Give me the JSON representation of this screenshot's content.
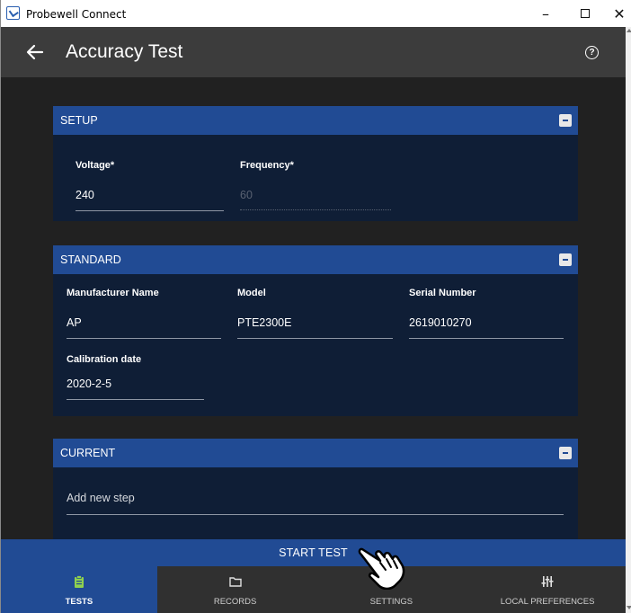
{
  "window": {
    "title": "Probewell Connect",
    "min": "–",
    "close": "✕"
  },
  "header": {
    "title": "Accuracy Test"
  },
  "setup": {
    "title": "SETUP",
    "voltage": {
      "label": "Voltage*",
      "value": "240"
    },
    "frequency": {
      "label": "Frequency*",
      "value": "60"
    }
  },
  "standard": {
    "title": "STANDARD",
    "manufacturer": {
      "label": "Manufacturer Name",
      "value": "AP"
    },
    "model": {
      "label": "Model",
      "value": "PTE2300E"
    },
    "serial": {
      "label": "Serial Number",
      "value": "2619010270"
    },
    "calibration": {
      "label": "Calibration date",
      "value": "2020-2-5"
    }
  },
  "current": {
    "title": "CURRENT",
    "add_step": "Add new step"
  },
  "start_test": "START TEST",
  "nav": [
    {
      "label": "TESTS",
      "icon": "clipboard-icon",
      "active": true
    },
    {
      "label": "RECORDS",
      "icon": "folder-icon",
      "active": false
    },
    {
      "label": "SETTINGS",
      "icon": "gear-icon",
      "active": false
    },
    {
      "label": "LOCAL PREFERENCES",
      "icon": "sliders-icon",
      "active": false
    }
  ],
  "colors": {
    "accent": "#214b94",
    "card": "#0f1e36",
    "background": "#212121",
    "appbar": "#3c3c3c"
  }
}
